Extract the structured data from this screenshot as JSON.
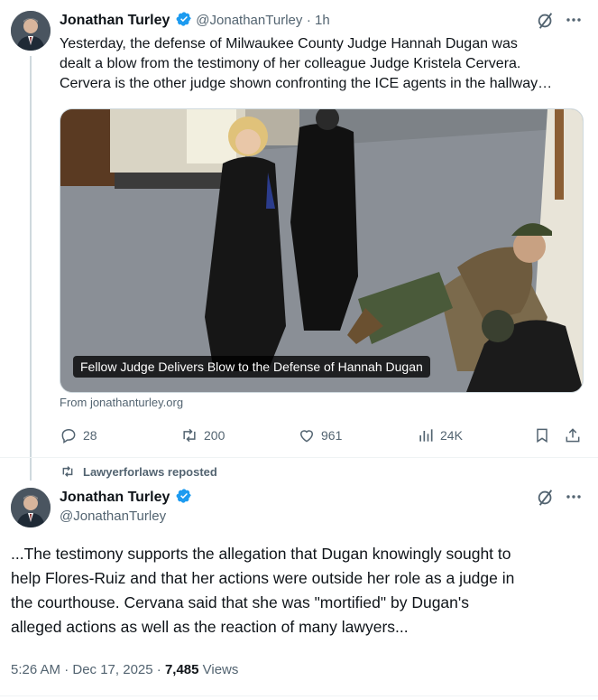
{
  "colors": {
    "verified": "#1d9bf0",
    "text": "#0f1419",
    "muted": "#536471",
    "divider": "#eff3f4"
  },
  "tweet1": {
    "name": "Jonathan Turley",
    "handle": "@JonathanTurley",
    "time": "· 1h",
    "text_lines": [
      "Yesterday, the defense of Milwaukee County Judge Hannah Dugan was",
      "dealt a blow from the testimony of her colleague Judge Kristela Cervera.",
      "Cervera is the other judge shown confronting the ICE agents in the hallway…"
    ],
    "card_caption": "Fellow Judge Delivers Blow to the Defense of Hannah Dugan",
    "card_source": "From jonathanturley.org",
    "actions": {
      "replies": "28",
      "reposts": "200",
      "likes": "961",
      "views": "24K"
    },
    "icons": [
      "grok-icon",
      "more-icon",
      "reply-icon",
      "repost-icon",
      "like-icon",
      "views-icon",
      "bookmark-icon",
      "share-icon"
    ]
  },
  "repost_banner": {
    "text": "Lawyerforlaws reposted"
  },
  "tweet2": {
    "name": "Jonathan Turley",
    "handle": "@JonathanTurley",
    "text_lines": [
      "...The testimony supports the allegation that Dugan knowingly sought to",
      "help Flores-Ruiz and that her actions were outside her role as a judge in",
      "the courthouse. Cervana said that she was \"mortified\" by Dugan's",
      "alleged actions as well as the reaction of many lawyers..."
    ],
    "timestamp": "5:26 AM · Dec 17, 2025 · ",
    "views_count": "7,485",
    "views_label": " Views"
  }
}
